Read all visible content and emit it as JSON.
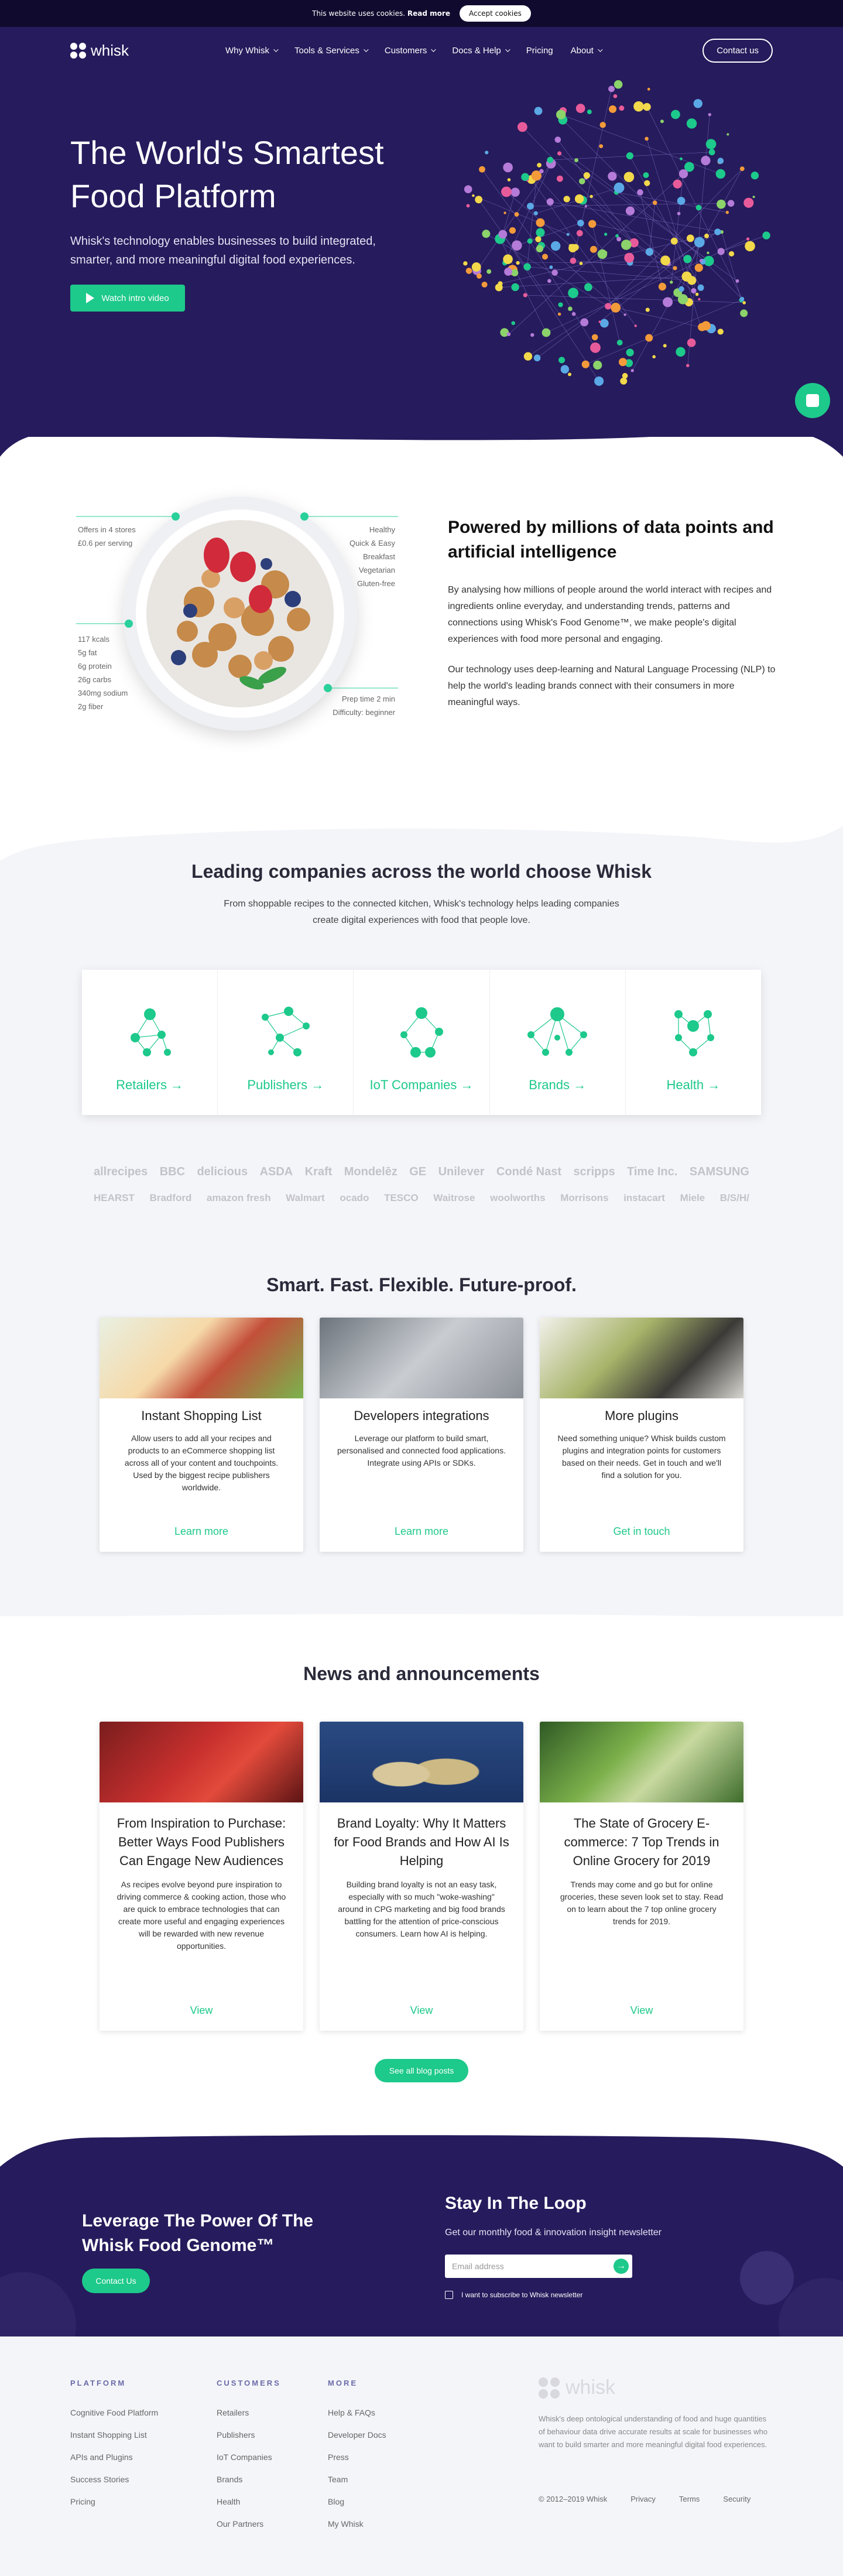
{
  "cookie": {
    "text": "This website uses cookies.",
    "link": "Read more",
    "button": "Accept cookies"
  },
  "nav": {
    "logo": "whisk",
    "items": [
      "Why Whisk",
      "Tools & Services",
      "Customers",
      "Docs & Help",
      "Pricing",
      "About"
    ],
    "contact": "Contact us"
  },
  "hero": {
    "title": "The World's Smartest Food Platform",
    "subtitle": "Whisk's technology enables businesses to build integrated, smarter, and more meaningful digital food experiences.",
    "button": "Watch intro video"
  },
  "powered": {
    "title": "Powered by millions of data points and artificial intelligence",
    "p1": "By analysing how millions of people around the world interact with recipes and ingredients online everyday, and understanding trends, patterns and connections using Whisk's Food Genome™, we make people's digital experiences with food more personal and engaging.",
    "p2": "Our technology uses deep-learning and Natural Language Processing (NLP) to help the world's leading brands connect with their consumers in more meaningful ways.",
    "left_top": [
      "Offers in 4 stores",
      "£0.6 per serving"
    ],
    "right_top": [
      "Healthy",
      "Quick & Easy",
      "Breakfast",
      "Vegetarian",
      "Gluten-free"
    ],
    "left_bottom": [
      "117 kcals",
      "5g fat",
      "6g protein",
      "26g carbs",
      "340mg sodium",
      "2g fiber"
    ],
    "right_bottom": [
      "Prep time 2 min",
      "Difficulty: beginner"
    ]
  },
  "companies": {
    "title": "Leading companies across the world choose Whisk",
    "subtitle": "From shoppable recipes to the connected kitchen, Whisk's technology helps leading companies create digital experiences with food that people love.",
    "categories": [
      "Retailers →",
      "Publishers →",
      "IoT Companies →",
      "Brands →",
      "Health →"
    ],
    "logos_row1": [
      "allrecipes",
      "BBC",
      "delicious",
      "ASDA",
      "Kraft",
      "Mondelēz",
      "GE",
      "Unilever",
      "Condé Nast",
      "scripps",
      "Time Inc.",
      "SAMSUNG"
    ],
    "logos_row2": [
      "HEARST",
      "Bradford",
      "amazon fresh",
      "Walmart",
      "ocado",
      "TESCO",
      "Waitrose",
      "woolworths",
      "Morrisons",
      "instacart",
      "Miele",
      "B/S/H/"
    ]
  },
  "features": {
    "title": "Smart. Fast. Flexible. Future-proof.",
    "cards": [
      {
        "title": "Instant Shopping List",
        "body": "Allow users to add all your recipes and products to an eCommerce shopping list across all of your content and touchpoints. Used by the biggest recipe publishers worldwide.",
        "link": "Learn more"
      },
      {
        "title": "Developers integrations",
        "body": "Leverage our platform to build smart, personalised and connected food applications. Integrate using APIs or SDKs.",
        "link": "Learn more"
      },
      {
        "title": "More plugins",
        "body": "Need something unique? Whisk builds custom plugins and integration points for customers based on their needs. Get in touch and we'll find a solution for you.",
        "link": "Get in touch"
      }
    ]
  },
  "news": {
    "title": "News and announcements",
    "cards": [
      {
        "title": "From Inspiration to Purchase: Better Ways Food Publishers Can Engage New Audiences",
        "body": "As recipes evolve beyond pure inspiration to driving commerce & cooking action, those who are quick to embrace technologies that can create more useful and engaging experiences will be rewarded with new revenue opportunities.",
        "link": "View"
      },
      {
        "title": "Brand Loyalty: Why It Matters for Food Brands and How AI Is Helping",
        "body": "Building brand loyalty is not an easy task, especially with so much \"woke-washing\" around in CPG marketing and big food brands battling for the attention of price-conscious consumers. Learn how AI is helping.",
        "link": "View"
      },
      {
        "title": "The State of Grocery E-commerce: 7 Top Trends in Online Grocery for 2019",
        "body": "Trends may come and go but for online groceries, these seven look set to stay. Read on to learn about the 7 top online grocery trends for 2019.",
        "link": "View"
      }
    ],
    "button": "See all blog posts"
  },
  "cta": {
    "title": "Leverage The Power Of The Whisk Food Genome™",
    "button": "Contact Us",
    "stay_title": "Stay In The Loop",
    "stay_sub": "Get our monthly food & innovation insight newsletter",
    "email_placeholder": "Email address",
    "go": "→",
    "checkbox": "I want to subscribe to Whisk newsletter"
  },
  "footer": {
    "platform": {
      "heading": "PLATFORM",
      "items": [
        "Cognitive Food Platform",
        "Instant Shopping List",
        "APIs and Plugins",
        "Success Stories",
        "Pricing"
      ]
    },
    "customers": {
      "heading": "CUSTOMERS",
      "items": [
        "Retailers",
        "Publishers",
        "IoT Companies",
        "Brands",
        "Health",
        "Our Partners"
      ]
    },
    "more": {
      "heading": "MORE",
      "items": [
        "Help & FAQs",
        "Developer Docs",
        "Press",
        "Team",
        "Blog",
        "My Whisk"
      ]
    },
    "logo": "whisk",
    "description": "Whisk's deep ontological understanding of food and huge quantities of behaviour data drive accurate results at scale for businesses who want to build smarter and more meaningful digital food experiences.",
    "copyright": "© 2012–2019 Whisk",
    "privacy": "Privacy",
    "terms": "Terms",
    "security": "Security"
  },
  "colors": {
    "brand": "#261b5c",
    "accent": "#1dc98b"
  }
}
